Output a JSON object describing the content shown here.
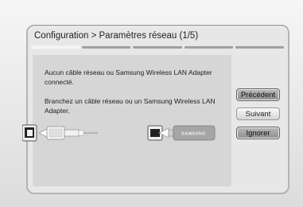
{
  "dialog": {
    "title": "Configuration > Paramètres réseau (1/5)",
    "step_current": 1,
    "step_total": 5,
    "message_1": "Aucun câble réseau ou Samsung Wireless LAN Adapter connecté.",
    "message_2": "Branchez un câble réseau ou un Samsung Wireless LAN Adapter."
  },
  "buttons": {
    "previous": "Précédent",
    "next": "Suivant",
    "ignore": "Ignorer"
  },
  "illustration": {
    "adapter_brand": "SAMSUNG"
  }
}
